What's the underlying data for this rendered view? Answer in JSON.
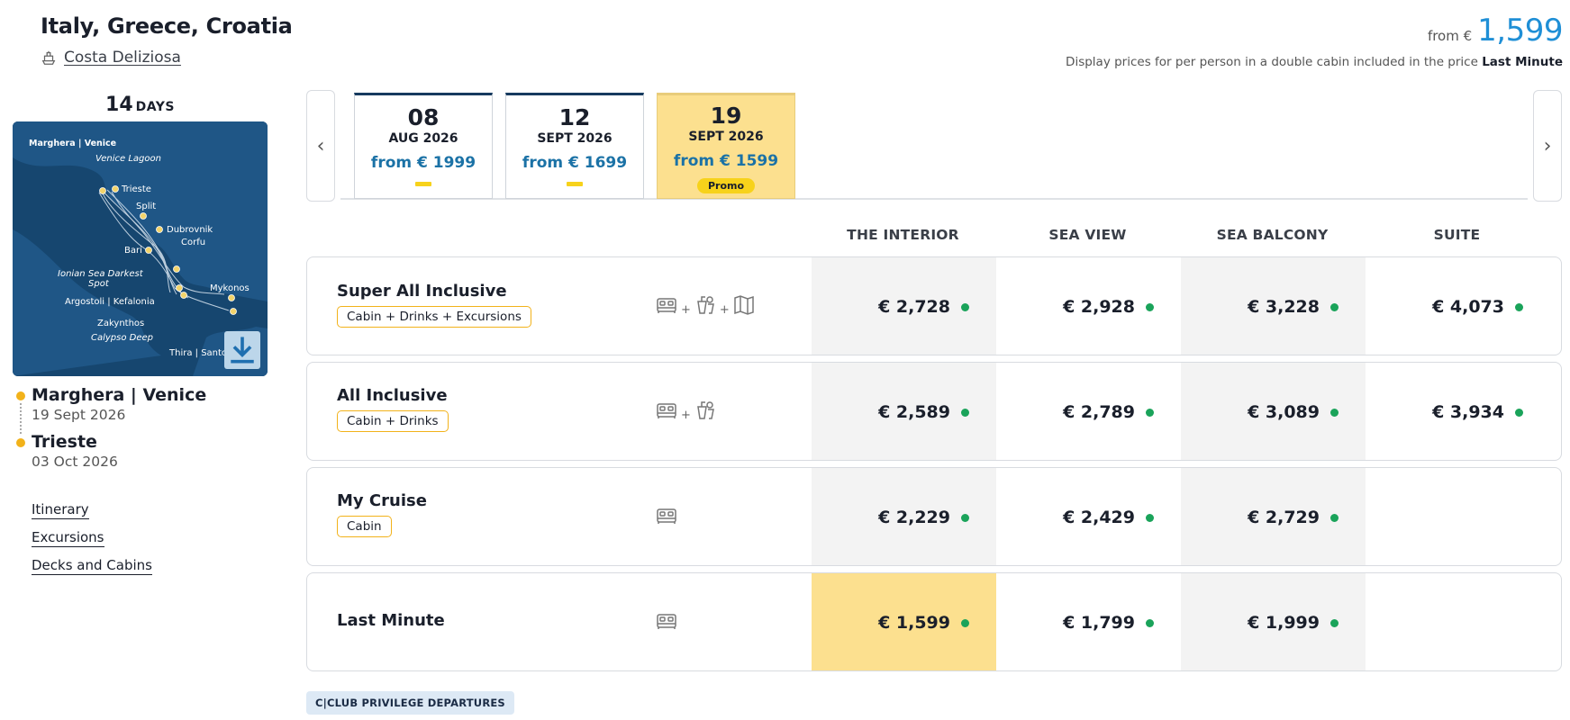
{
  "header": {
    "title": "Italy, Greece, Croatia",
    "ship_name": "Costa Deliziosa",
    "from_label": "from €",
    "from_price": "1,599",
    "display_note": "Display prices for per person in a double cabin included in the price",
    "display_note_bold": "Last Minute"
  },
  "sidebar": {
    "days_number": "14",
    "days_label": "DAYS",
    "map_labels": {
      "marghera": "Marghera | Venice",
      "venice_lagoon": "Venice Lagoon",
      "trieste": "Trieste",
      "split": "Split",
      "dubrovnik": "Dubrovnik",
      "corfu": "Corfu",
      "bari": "Bari",
      "ionian_1": "Ionian Sea Darkest",
      "ionian_2": "Spot",
      "mykonos": "Mykonos",
      "argostoli": "Argostoli | Kefalonia",
      "zakynthos": "Zakynthos",
      "calypso": "Calypso Deep",
      "thira": "Thira | Santorini"
    },
    "stops": [
      {
        "city": "Marghera | Venice",
        "date": "19 Sept 2026"
      },
      {
        "city": "Trieste",
        "date": "03 Oct 2026"
      }
    ],
    "links": [
      "Itinerary",
      "Excursions",
      "Decks and Cabins"
    ]
  },
  "dates": [
    {
      "day": "08",
      "month": "AUG 2026",
      "price": "from € 1999",
      "promo": ""
    },
    {
      "day": "12",
      "month": "SEPT 2026",
      "price": "from € 1699",
      "promo": ""
    },
    {
      "day": "19",
      "month": "SEPT 2026",
      "price": "from € 1599",
      "promo": "Promo"
    }
  ],
  "columns": [
    "THE INTERIOR",
    "SEA VIEW",
    "SEA BALCONY",
    "SUITE"
  ],
  "icon_plus": "+",
  "packages": [
    {
      "name": "Super All Inclusive",
      "tag": "Cabin + Drinks + Excursions",
      "prices": [
        "€ 2,728",
        "€ 2,928",
        "€ 3,228",
        "€ 4,073"
      ]
    },
    {
      "name": "All Inclusive",
      "tag": "Cabin + Drinks",
      "prices": [
        "€ 2,589",
        "€ 2,789",
        "€ 3,089",
        "€ 3,934"
      ]
    },
    {
      "name": "My Cruise",
      "tag": "Cabin",
      "prices": [
        "€ 2,229",
        "€ 2,429",
        "€ 2,729"
      ]
    },
    {
      "name": "Last Minute",
      "tag": "",
      "prices": [
        "€ 1,599",
        "€ 1,799",
        "€ 1,999"
      ]
    }
  ],
  "club_badge": "C|CLUB PRIVILEGE DEPARTURES",
  "colors": {
    "accent_blue": "#1f8fd6",
    "promo_yellow": "#fce08f",
    "available_green": "#1aa35a",
    "tag_border": "#f2b21a"
  }
}
